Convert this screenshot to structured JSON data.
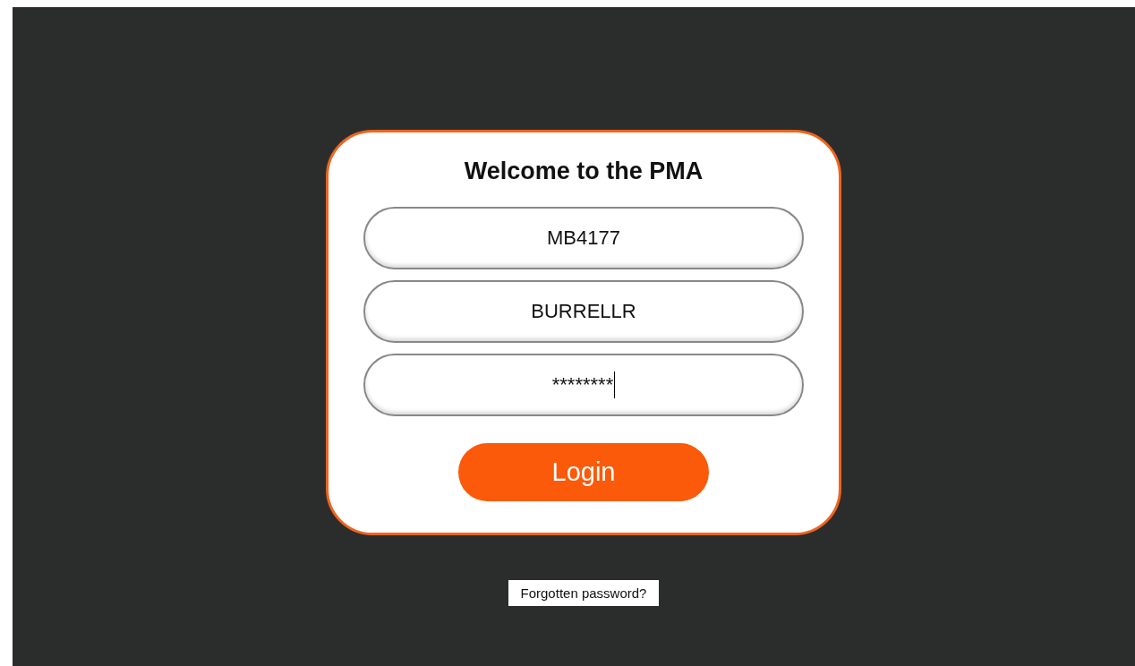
{
  "login_card": {
    "title": "Welcome to the PMA",
    "fields": [
      {
        "value": "MB4177",
        "focused": false
      },
      {
        "value": "BURRELLR",
        "focused": false
      },
      {
        "value": "********",
        "focused": true
      }
    ],
    "login_button": "Login"
  },
  "forgotten_password_link": "Forgotten password?"
}
